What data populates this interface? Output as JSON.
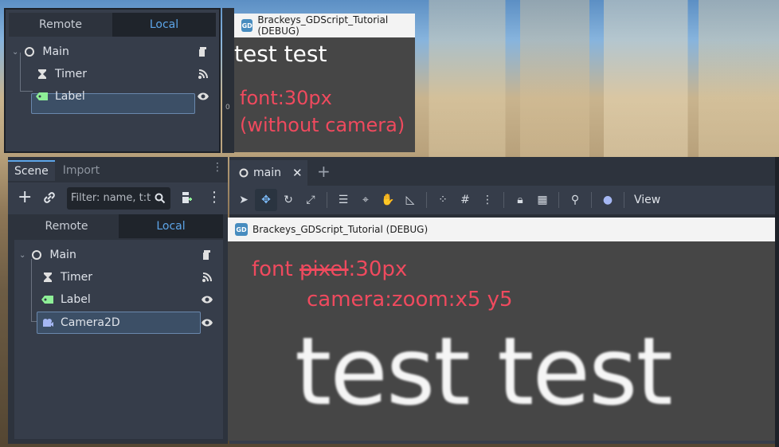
{
  "top_panel": {
    "tabs": [
      "Remote",
      "Local"
    ],
    "tree": [
      {
        "label": "Main",
        "icon": "node-circle-icon"
      },
      {
        "label": "Timer",
        "icon": "hourglass-icon"
      },
      {
        "label": "Label",
        "icon": "label-tag-icon"
      }
    ]
  },
  "top_window": {
    "title": "Brackeys_GDScript_Tutorial (DEBUG)",
    "game_text": "test test",
    "annotation_line1": "font:30px",
    "annotation_line2": "(without camera)",
    "ruler_mark": "0"
  },
  "bottom_panel": {
    "dock_tabs": [
      "Scene",
      "Import"
    ],
    "filter_placeholder": "Filter: name, t:t",
    "rl_tabs": [
      "Remote",
      "Local"
    ],
    "tree": [
      {
        "label": "Main"
      },
      {
        "label": "Timer"
      },
      {
        "label": "Label"
      },
      {
        "label": "Camera2D"
      }
    ]
  },
  "editor": {
    "tab_label": "main",
    "view_menu": "View"
  },
  "bottom_window": {
    "title": "Brackeys_GDScript_Tutorial (DEBUG)",
    "annotation_prefix": "font ",
    "annotation_struck": "pixel",
    "annotation_suffix": ":30px",
    "annotation_line2": "camera:zoom:x5 y5",
    "game_text": "test test"
  },
  "colors": {
    "panel": "#363d4a",
    "active_tab_text": "#5da5e8",
    "annotation_red": "#ef4a5e",
    "label_icon_green": "#8eef97",
    "camera_icon_purple": "#a5b7f3"
  }
}
